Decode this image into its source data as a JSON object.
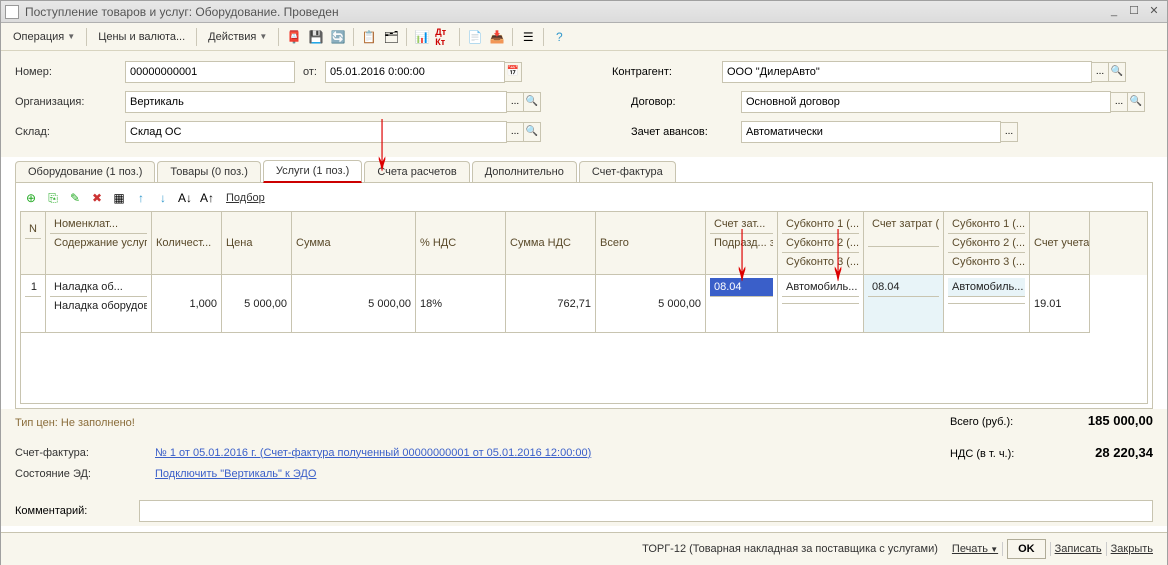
{
  "window": {
    "title": "Поступление товаров и услуг: Оборудование. Проведен"
  },
  "menus": {
    "operation": "Операция",
    "prices": "Цены и валюта...",
    "actions": "Действия"
  },
  "form": {
    "number_label": "Номер:",
    "number": "00000000001",
    "from_label": "от:",
    "date": "05.01.2016 0:00:00",
    "org_label": "Организация:",
    "org": "Вертикаль",
    "warehouse_label": "Склад:",
    "warehouse": "Склад ОС",
    "counterparty_label": "Контрагент:",
    "counterparty": "ООО \"ДилерАвто\"",
    "contract_label": "Договор:",
    "contract": "Основной договор",
    "advance_label": "Зачет авансов:",
    "advance": "Автоматически"
  },
  "tabs": {
    "equipment": "Оборудование (1 поз.)",
    "goods": "Товары (0 поз.)",
    "services": "Услуги (1 поз.)",
    "accounts": "Счета расчетов",
    "additional": "Дополнительно",
    "invoice": "Счет-фактура"
  },
  "tableToolbar": {
    "selection": "Подбор"
  },
  "headers": {
    "n": "N",
    "nomen1": "Номенклат...",
    "nomen2": "Содержание услуги, до...",
    "qty": "Количест...",
    "price": "Цена",
    "sum": "Сумма",
    "vat": "% НДС",
    "vatsum": "Сумма НДС",
    "total": "Всего",
    "acc1": "Счет зат...",
    "acc2": "Подразд... затрат",
    "sub1": "Субконто 1 (...",
    "sub2": "Субконто 2 (...",
    "sub3": "Субконто 3 (...",
    "accnu1": "Счет затрат (НУ)",
    "subnu1": "Субконто 1 (...",
    "subnu2": "Субконто 2 (...",
    "subnu3": "Субконто 3 (...",
    "vatacc": "Счет учета НДС"
  },
  "row": {
    "n": "1",
    "nomen1": "Наладка об...",
    "nomen2": "Наладка оборудова...",
    "qty": "1,000",
    "price": "5 000,00",
    "sum": "5 000,00",
    "vat": "18%",
    "vatsum": "762,71",
    "total": "5 000,00",
    "acc": "08.04",
    "sub1": "Автомобиль...",
    "accnu": "08.04",
    "subnu1": "Автомобиль...",
    "vatacc": "19.01"
  },
  "footer": {
    "price_type": "Тип цен: Не заполнено!",
    "invoice_lbl": "Счет-фактура:",
    "invoice_link": "№ 1 от 05.01.2016 г. (Счет-фактура полученный 00000000001 от 05.01.2016 12:00:00)",
    "edo_lbl": "Состояние ЭД:",
    "edo_link": "Подключить \"Вертикаль\" к ЭДО",
    "comment_lbl": "Комментарий:",
    "total_lbl": "Всего (руб.):",
    "total_val": "185 000,00",
    "vat_lbl": "НДС (в т. ч.):",
    "vat_val": "28 220,34"
  },
  "bottom": {
    "info": "ТОРГ-12 (Товарная накладная за поставщика с услугами)",
    "print": "Печать",
    "ok": "OK",
    "save": "Записать",
    "close": "Закрыть"
  }
}
